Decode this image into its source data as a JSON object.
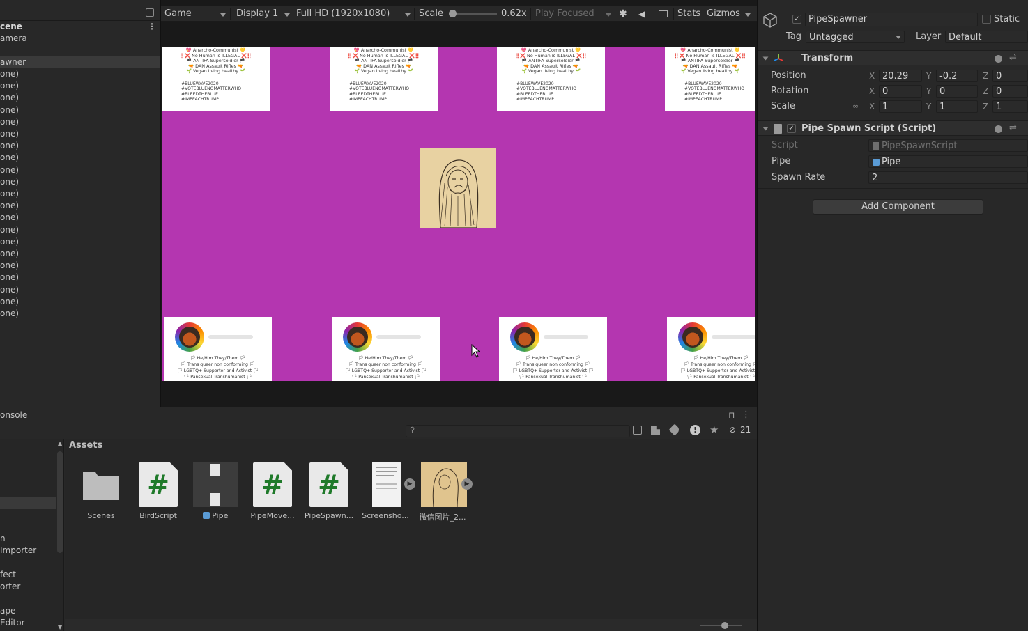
{
  "hierarchy": {
    "items": [
      "cene",
      "amera",
      "awner",
      "one)",
      "one)",
      "one)",
      "one)",
      "one)",
      "one)",
      "one)",
      "one)",
      "one)",
      "one)",
      "one)",
      "one)",
      "one)",
      "one)",
      "one)",
      "one)",
      "one)",
      "one)",
      "one)",
      "one)",
      "one)"
    ]
  },
  "game_toolbar": {
    "view": "Game",
    "display": "Display 1",
    "resolution": "Full HD (1920x1080)",
    "scale_label": "Scale",
    "scale_value": "0.62x",
    "play_mode": "Play Focused",
    "stats": "Stats",
    "gizmos": "Gizmos"
  },
  "game_view": {
    "top_card": {
      "lines": [
        "💖 Anarcho-Communist 💛",
        "‼️❌ No Human is ILLEGAL ❌‼️",
        "🏴 ANTIFA Supersoldier 🏴",
        "🔫 DAN Assault Rifles 🔫",
        "🌱 Vegan living healthy 🌱"
      ],
      "tags": [
        "#BLUEWAVE2020",
        "#VOTEBLUENOMATTERWHO",
        "#BLEEDTHEBLUE",
        "#IMPEACHTRUMP"
      ]
    },
    "bottom_card": {
      "lines": [
        "🏳 He/Him They/Them 🏳",
        "🏳 Trans queer non conforming 🏳",
        "🏳 LGBTQ+ Supporter and Activist 🏳",
        "🏳 Pansexual Transhumanist 🏳"
      ]
    }
  },
  "inspector": {
    "object_name": "PipeSpawner",
    "static_label": "Static",
    "tag_label": "Tag",
    "tag_value": "Untagged",
    "layer_label": "Layer",
    "layer_value": "Default",
    "transform": {
      "title": "Transform",
      "position_label": "Position",
      "rotation_label": "Rotation",
      "scale_label": "Scale",
      "position": {
        "x": "20.29",
        "y": "-0.2",
        "z": "0"
      },
      "rotation": {
        "x": "0",
        "y": "0",
        "z": "0"
      },
      "scale": {
        "x": "1",
        "y": "1",
        "z": "1"
      }
    },
    "script_component": {
      "title": "Pipe Spawn Script (Script)",
      "script_label": "Script",
      "script_value": "PipeSpawnScript",
      "pipe_label": "Pipe",
      "pipe_value": "Pipe",
      "spawn_rate_label": "Spawn Rate",
      "spawn_rate_value": "2"
    },
    "add_component": "Add Component"
  },
  "bottom": {
    "console_tab": "onsole",
    "assets_label": "Assets",
    "hidden_count": "21",
    "sidebar_items": [
      "n",
      "Importer",
      "fect",
      "orter",
      "ape",
      "Editor"
    ],
    "assets": [
      {
        "name": "Scenes",
        "kind": "folder"
      },
      {
        "name": "BirdScript",
        "kind": "script"
      },
      {
        "name": "Pipe",
        "kind": "prefab"
      },
      {
        "name": "PipeMove...",
        "kind": "script"
      },
      {
        "name": "PipeSpawn...",
        "kind": "script"
      },
      {
        "name": "Screensho...",
        "kind": "image"
      },
      {
        "name": "微信图片_2...",
        "kind": "image"
      }
    ]
  },
  "colors": {
    "game_background": "#b436b0",
    "panel": "#282828",
    "script_hash": "#1f7a2a"
  }
}
